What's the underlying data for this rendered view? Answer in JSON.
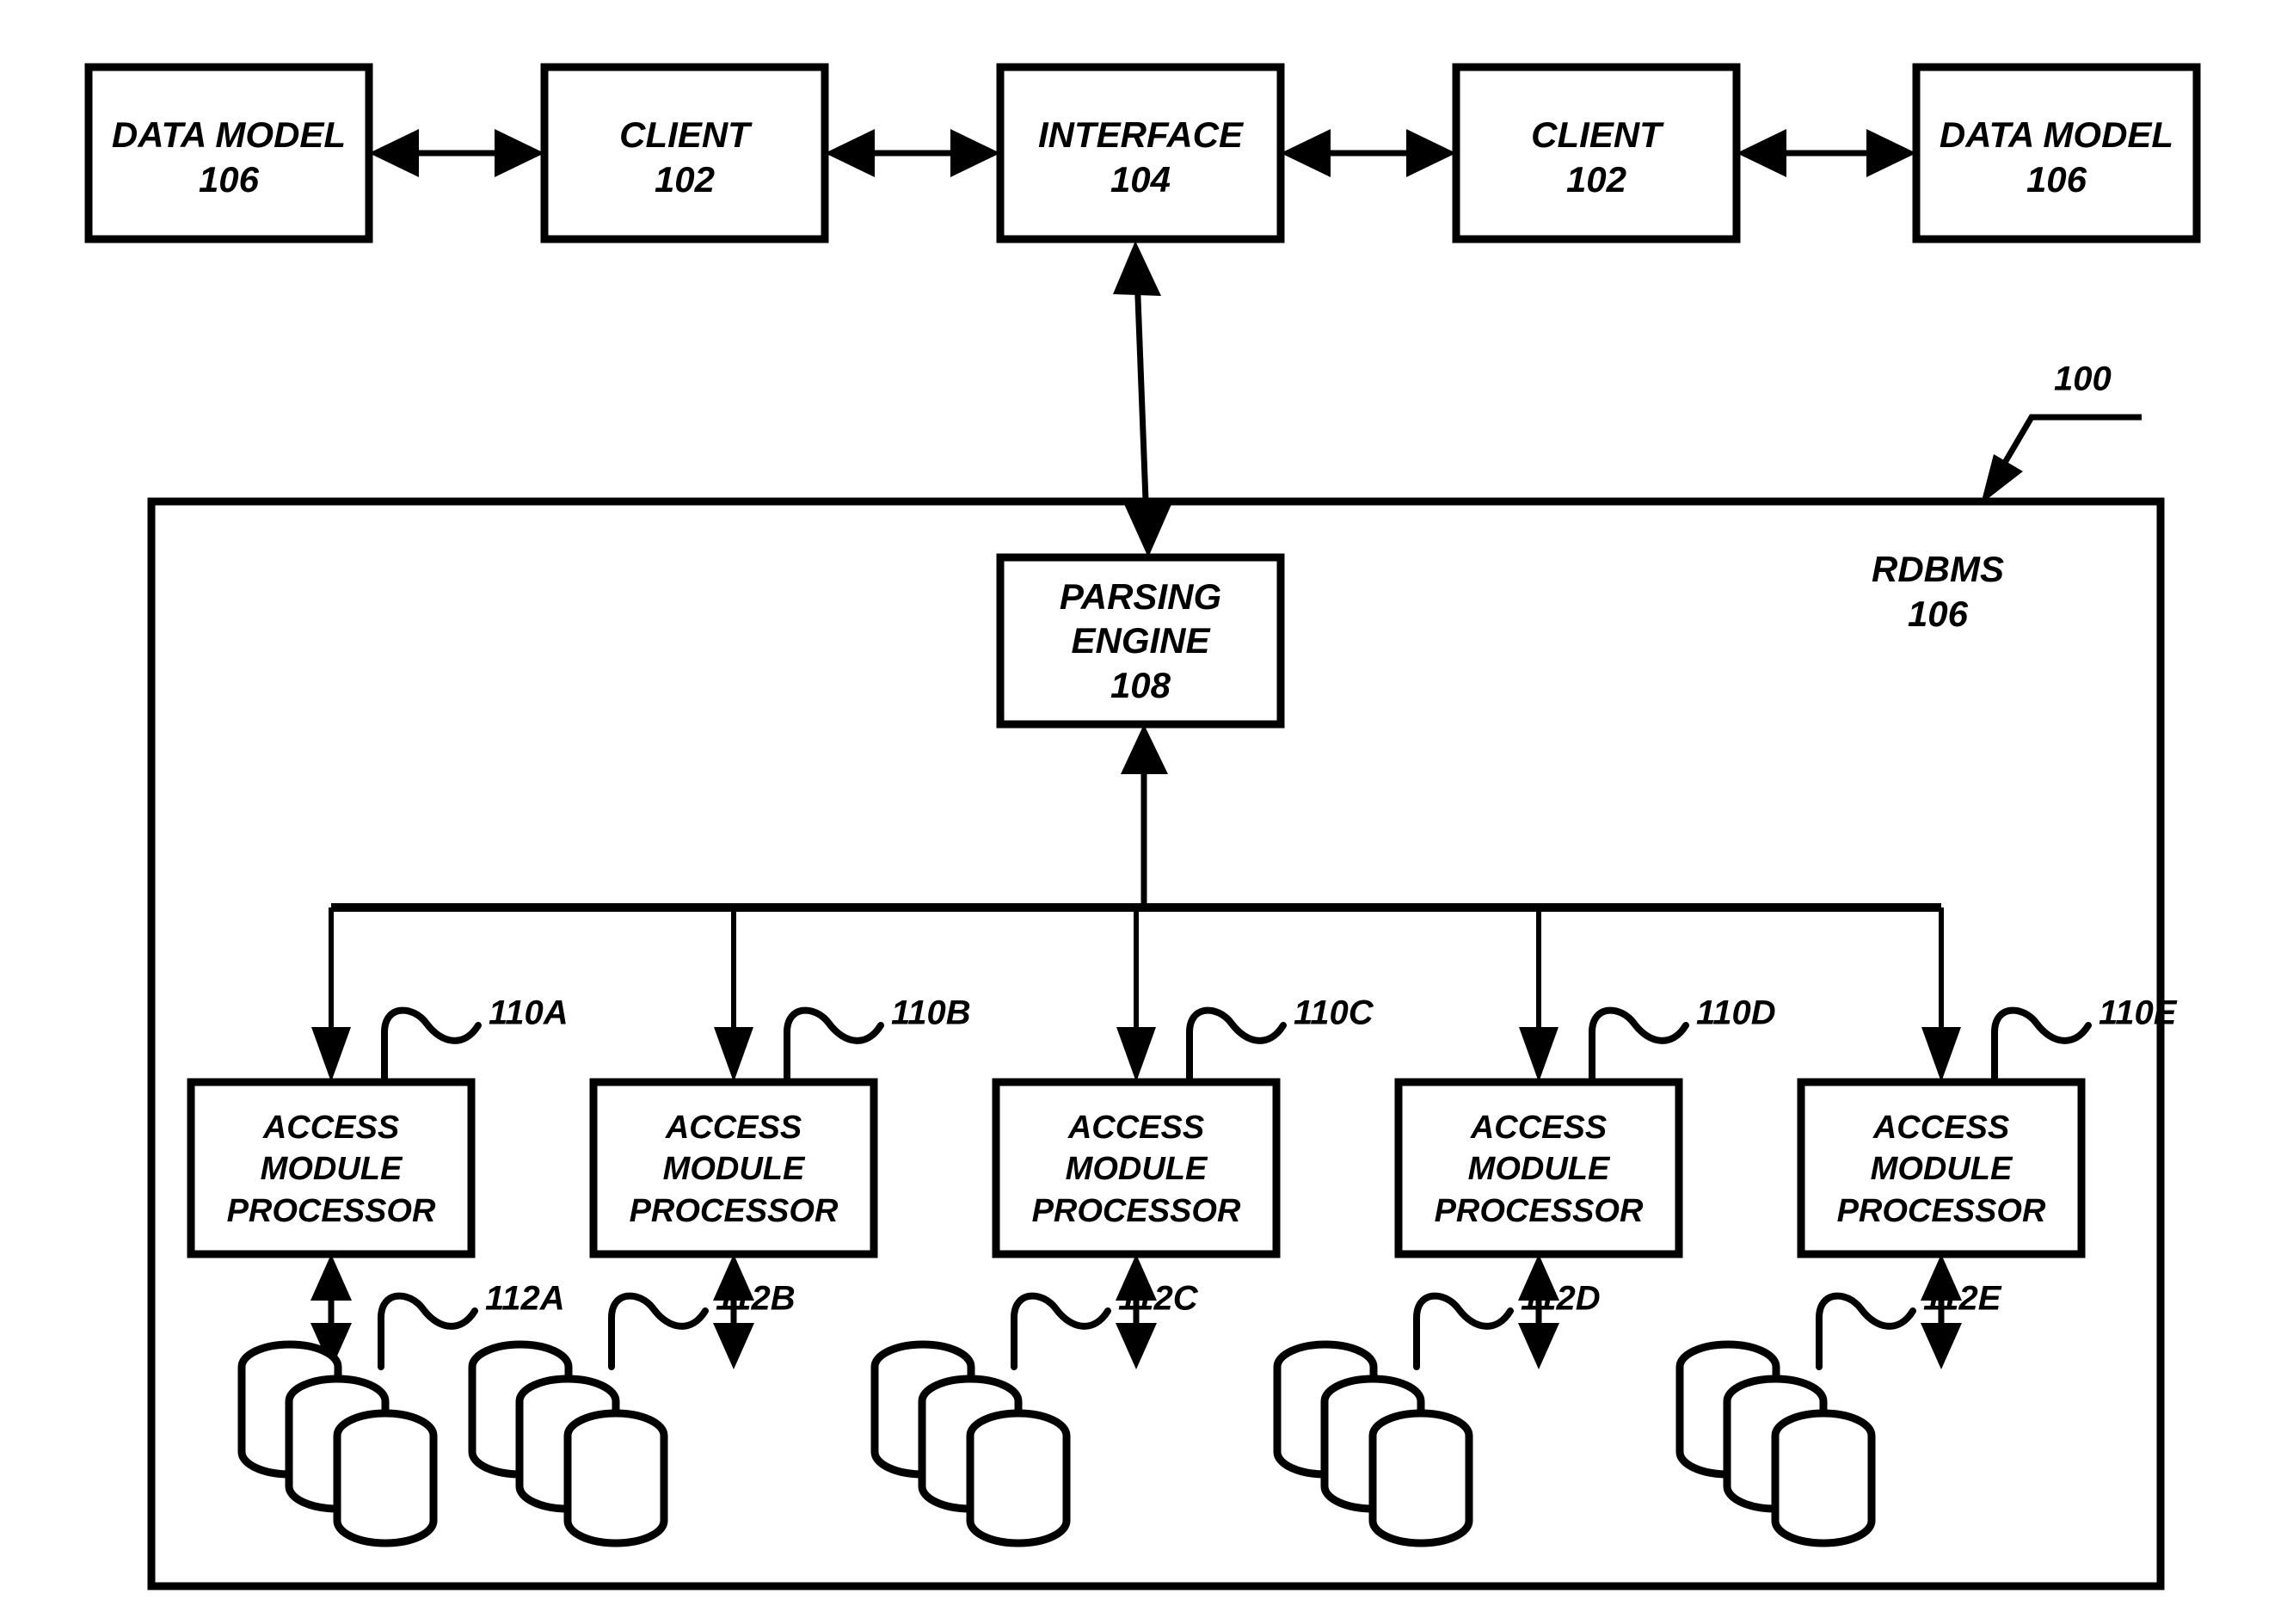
{
  "figure": {
    "reference_numeral": "100",
    "system_label": "RDBMS",
    "system_numeral": "106"
  },
  "top_row": {
    "boxes": [
      {
        "title": "DATA MODEL",
        "numeral": "106",
        "name": "data-model-left"
      },
      {
        "title": "CLIENT",
        "numeral": "102",
        "name": "client-left"
      },
      {
        "title": "INTERFACE",
        "numeral": "104",
        "name": "interface"
      },
      {
        "title": "CLIENT",
        "numeral": "102",
        "name": "client-right"
      },
      {
        "title": "DATA MODEL",
        "numeral": "106",
        "name": "data-model-right"
      }
    ]
  },
  "parsing_engine": {
    "line1": "PARSING",
    "line2": "ENGINE",
    "numeral": "108"
  },
  "access_modules": [
    {
      "line1": "ACCESS",
      "line2": "MODULE",
      "line3": "PROCESSOR",
      "ref": "110A",
      "storage_ref": "112A"
    },
    {
      "line1": "ACCESS",
      "line2": "MODULE",
      "line3": "PROCESSOR",
      "ref": "110B",
      "storage_ref": "112B"
    },
    {
      "line1": "ACCESS",
      "line2": "MODULE",
      "line3": "PROCESSOR",
      "ref": "110C",
      "storage_ref": "112C"
    },
    {
      "line1": "ACCESS",
      "line2": "MODULE",
      "line3": "PROCESSOR",
      "ref": "110D",
      "storage_ref": "112D"
    },
    {
      "line1": "ACCESS",
      "line2": "MODULE",
      "line3": "PROCESSOR",
      "ref": "110E",
      "storage_ref": "112E"
    }
  ],
  "colors": {
    "ink": "#000000",
    "paper": "#ffffff"
  }
}
